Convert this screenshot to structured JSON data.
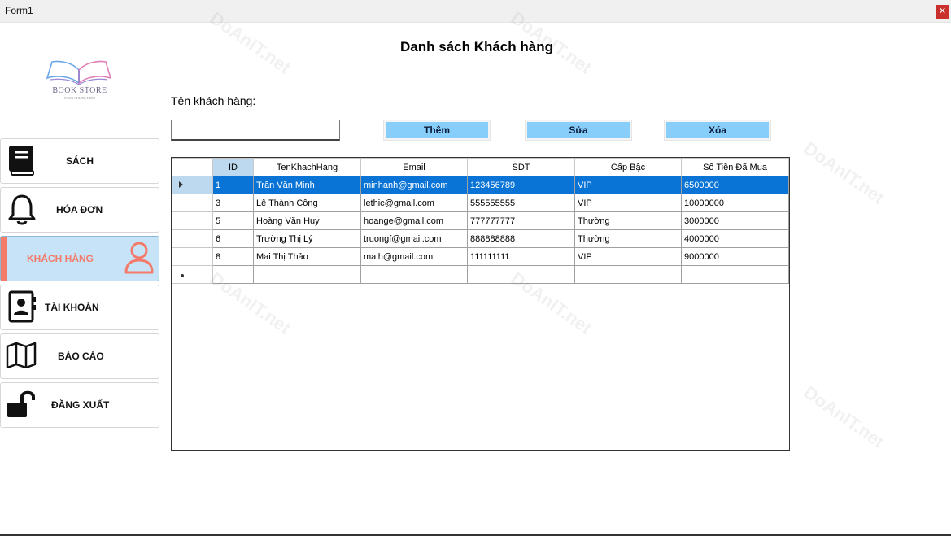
{
  "window": {
    "title": "Form1",
    "close_glyph": "✕"
  },
  "logo": {
    "brand": "BOOK STORE",
    "tagline": "YOUR ONLINE HERE"
  },
  "page_title": "Danh sách Khách hàng",
  "search": {
    "label": "Tên khách hàng:",
    "value": ""
  },
  "buttons": {
    "add": "Thêm",
    "edit": "Sửa",
    "delete": "Xóa"
  },
  "sidebar": {
    "items": [
      {
        "label": "SÁCH",
        "icon": "book-icon"
      },
      {
        "label": "HÓA ĐƠN",
        "icon": "bell-icon"
      },
      {
        "label": "KHÁCH HÀNG",
        "icon": "user-icon",
        "active": true
      },
      {
        "label": "TÀI KHOẢN",
        "icon": "contact-book-icon"
      },
      {
        "label": "BÁO CÁO",
        "icon": "map-icon"
      },
      {
        "label": "ĐĂNG XUẤT",
        "icon": "unlock-icon"
      }
    ]
  },
  "table": {
    "columns": [
      "ID",
      "TenKhachHang",
      "Email",
      "SDT",
      "Cấp Bậc",
      "Số Tiền Đã Mua"
    ],
    "rows": [
      [
        "1",
        "Trần Văn Minh",
        "minhanh@gmail.com",
        "123456789",
        "VIP",
        "6500000"
      ],
      [
        "3",
        "Lê Thành Công",
        "lethic@gmail.com",
        "555555555",
        "VIP",
        "10000000"
      ],
      [
        "5",
        "Hoàng Văn Huy",
        "hoange@gmail.com",
        "777777777",
        "Thường",
        "3000000"
      ],
      [
        "6",
        "Trường Thị Lý",
        "truongf@gmail.com",
        "888888888",
        "Thường",
        "4000000"
      ],
      [
        "8",
        "Mai Thị Thảo",
        "maih@gmail.com",
        "111111111",
        "VIP",
        "9000000"
      ]
    ],
    "selected_row": 0
  },
  "watermark": "DoAnIT.net",
  "colors": {
    "button_bg": "#87cefa",
    "active_nav_bg": "#c7e3f7",
    "active_nav_accent": "#f47a6a",
    "selection": "#0a74d6"
  }
}
